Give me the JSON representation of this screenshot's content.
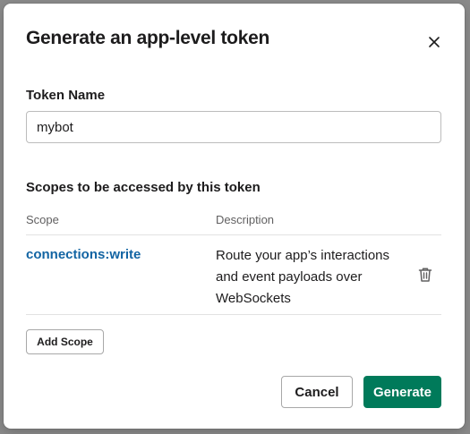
{
  "dialog": {
    "title": "Generate an app-level token",
    "close_icon": "close-icon"
  },
  "token_name": {
    "label": "Token Name",
    "value": "mybot",
    "placeholder": ""
  },
  "scopes": {
    "heading": "Scopes to be accessed by this token",
    "columns": {
      "scope": "Scope",
      "description": "Description"
    },
    "rows": [
      {
        "scope": "connections:write",
        "description": "Route your app’s interactions and event payloads over WebSockets",
        "delete_icon": "trash-icon"
      }
    ],
    "add_label": "Add Scope"
  },
  "actions": {
    "cancel_label": "Cancel",
    "generate_label": "Generate"
  },
  "colors": {
    "link": "#1264a3",
    "primary": "#007a5a",
    "text": "#1d1c1d",
    "muted": "#616061"
  }
}
